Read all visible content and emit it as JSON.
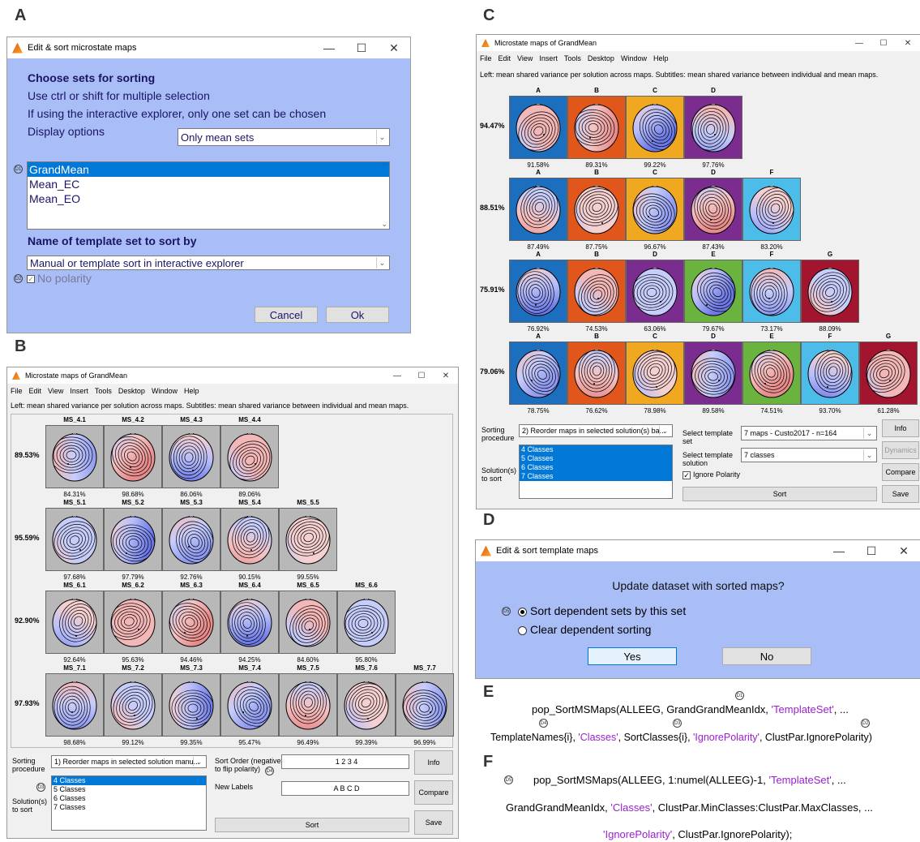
{
  "panels": {
    "a": "A",
    "b": "B",
    "c": "C",
    "d": "D",
    "e": "E",
    "f": "F"
  },
  "dialog_a": {
    "title": "Edit & sort microstate maps",
    "heading1": "Choose sets for sorting",
    "line1": "Use ctrl or shift for multiple selection",
    "line2": "If using the interactive explorer, only one set can be chosen",
    "display_label": "Display options",
    "display_value": "Only mean sets",
    "sets": [
      "GrandMean",
      "Mean_EC",
      "Mean_EO"
    ],
    "heading2": "Name of template set to sort by",
    "template_value": "Manual or template sort in interactive explorer",
    "no_polarity": "No polarity",
    "cancel": "Cancel",
    "ok": "Ok",
    "d1": "D1",
    "d2": "D2"
  },
  "window_b": {
    "title": "Microstate maps of GrandMean",
    "menu": [
      "File",
      "Edit",
      "View",
      "Insert",
      "Tools",
      "Desktop",
      "Window",
      "Help"
    ],
    "caption": "Left: mean shared variance per solution across maps. Subtitles: mean shared variance between individual and mean maps.",
    "rows": [
      {
        "label": "89.53%",
        "maps": [
          {
            "n": "MS_4.1",
            "v": "84.31%"
          },
          {
            "n": "MS_4.2",
            "v": "98.68%"
          },
          {
            "n": "MS_4.3",
            "v": "86.06%"
          },
          {
            "n": "MS_4.4",
            "v": "89.06%"
          }
        ]
      },
      {
        "label": "95.59%",
        "maps": [
          {
            "n": "MS_5.1",
            "v": "97.68%"
          },
          {
            "n": "MS_5.2",
            "v": "97.79%"
          },
          {
            "n": "MS_5.3",
            "v": "92.76%"
          },
          {
            "n": "MS_5.4",
            "v": "90.15%"
          },
          {
            "n": "MS_5.5",
            "v": "99.55%"
          }
        ]
      },
      {
        "label": "92.90%",
        "maps": [
          {
            "n": "MS_6.1",
            "v": "92.64%"
          },
          {
            "n": "MS_6.2",
            "v": "95.63%"
          },
          {
            "n": "MS_6.3",
            "v": "94.46%"
          },
          {
            "n": "MS_6.4",
            "v": "94.25%"
          },
          {
            "n": "MS_6.5",
            "v": "84.60%"
          },
          {
            "n": "MS_6.6",
            "v": "95.80%"
          }
        ]
      },
      {
        "label": "97.93%",
        "maps": [
          {
            "n": "MS_7.1",
            "v": "98.68%"
          },
          {
            "n": "MS_7.2",
            "v": "99.12%"
          },
          {
            "n": "MS_7.3",
            "v": "99.35%"
          },
          {
            "n": "MS_7.4",
            "v": "95.47%"
          },
          {
            "n": "MS_7.5",
            "v": "96.49%"
          },
          {
            "n": "MS_7.6",
            "v": "99.39%"
          },
          {
            "n": "MS_7.7",
            "v": "96.99%"
          }
        ]
      }
    ],
    "sorting_label": "Sorting procedure",
    "sorting_value": "1) Reorder maps in selected solution manu...",
    "solutions_label": "Solution(s) to sort",
    "solutions": [
      "4 Classes",
      "5 Classes",
      "6 Classes",
      "7 Classes"
    ],
    "sort_order_label": "Sort Order (negative to flip polarity)",
    "sort_order_value": "1 2 3 4",
    "new_labels_label": "New Labels",
    "new_labels_value": "A B C D",
    "sort": "Sort",
    "info": "Info",
    "compare": "Compare",
    "save": "Save",
    "d3": "D3",
    "d4": "D4"
  },
  "window_c": {
    "title": "Microstate maps of GrandMean",
    "menu": [
      "File",
      "Edit",
      "View",
      "Insert",
      "Tools",
      "Desktop",
      "Window",
      "Help"
    ],
    "caption": "Left: mean shared variance per solution across maps. Subtitles: mean shared variance between individual and mean maps.",
    "rows": [
      {
        "label": "94.47%",
        "maps": [
          {
            "n": "A",
            "v": "91.58%",
            "c": "#1c6fbe"
          },
          {
            "n": "B",
            "v": "89.31%",
            "c": "#e0561b"
          },
          {
            "n": "C",
            "v": "99.22%",
            "c": "#f0a820"
          },
          {
            "n": "D",
            "v": "97.76%",
            "c": "#7a2d8f"
          }
        ]
      },
      {
        "label": "88.51%",
        "maps": [
          {
            "n": "A",
            "v": "87.49%",
            "c": "#1c6fbe"
          },
          {
            "n": "B",
            "v": "87.75%",
            "c": "#e0561b"
          },
          {
            "n": "C",
            "v": "96.67%",
            "c": "#f0a820"
          },
          {
            "n": "D",
            "v": "87.43%",
            "c": "#7a2d8f"
          },
          {
            "n": "F",
            "v": "83.20%",
            "c": "#4bbde8"
          }
        ]
      },
      {
        "label": "75.91%",
        "maps": [
          {
            "n": "A",
            "v": "76.92%",
            "c": "#1c6fbe"
          },
          {
            "n": "B",
            "v": "74.53%",
            "c": "#e0561b"
          },
          {
            "n": "D",
            "v": "63.06%",
            "c": "#7a2d8f"
          },
          {
            "n": "E",
            "v": "79.67%",
            "c": "#6ab33e"
          },
          {
            "n": "F",
            "v": "73.17%",
            "c": "#4bbde8"
          },
          {
            "n": "G",
            "v": "88.09%",
            "c": "#a3142e"
          }
        ]
      },
      {
        "label": "79.06%",
        "maps": [
          {
            "n": "A",
            "v": "78.75%",
            "c": "#1c6fbe"
          },
          {
            "n": "B",
            "v": "76.62%",
            "c": "#e0561b"
          },
          {
            "n": "C",
            "v": "78.98%",
            "c": "#f0a820"
          },
          {
            "n": "D",
            "v": "89.58%",
            "c": "#7a2d8f"
          },
          {
            "n": "E",
            "v": "74.51%",
            "c": "#6ab33e"
          },
          {
            "n": "F",
            "v": "93.70%",
            "c": "#4bbde8"
          },
          {
            "n": "G",
            "v": "61.28%",
            "c": "#a3142e"
          }
        ]
      }
    ],
    "sorting_label": "Sorting procedure",
    "sorting_value": "2) Reorder maps in selected solution(s) ba...",
    "solutions_label": "Solution(s) to sort",
    "solutions": [
      "4 Classes",
      "5 Classes",
      "6 Classes",
      "7 Classes"
    ],
    "template_set_label": "Select template set",
    "template_set_value": "7 maps - Custo2017 - n=164",
    "template_solution_label": "Select template solution",
    "template_solution_value": "7 classes",
    "ignore_polarity": "Ignore Polarity",
    "sort": "Sort",
    "info": "Info",
    "dynamics": "Dynamics",
    "compare": "Compare",
    "save": "Save"
  },
  "dialog_d": {
    "title": "Edit & sort template maps",
    "question": "Update dataset with sorted maps?",
    "opt1": "Sort dependent sets by this set",
    "opt2": "Clear dependent sorting",
    "yes": "Yes",
    "no": "No",
    "d5": "D5"
  },
  "code_e": {
    "l1a": "pop_SortMSMaps(ALLEEG, GrandGrandMeanIdx, ",
    "l1b": "'TemplateSet'",
    "l1c": ", ...",
    "l2a": "TemplateNames{i}, ",
    "l2b": "'Classes'",
    "l2c": ", SortClasses{i}, ",
    "l2d": "'IgnorePolarity'",
    "l2e": ", ClustPar.IgnorePolarity)",
    "d1": "D1",
    "d4": "D4",
    "d3": "D3",
    "d2": "D2"
  },
  "code_f": {
    "l1a": "pop_SortMSMaps(ALLEEG, 1:numel(ALLEEG)-1, ",
    "l1b": "'TemplateSet'",
    "l1c": ", ...",
    "l2a": "GrandGrandMeanIdx, ",
    "l2b": "'Classes'",
    "l2c": ", ClustPar.MinClasses:ClustPar.MaxClasses, ...",
    "l3a": "'IgnorePolarity'",
    "l3b": ", ClustPar.IgnorePolarity);",
    "d5": "D5"
  }
}
